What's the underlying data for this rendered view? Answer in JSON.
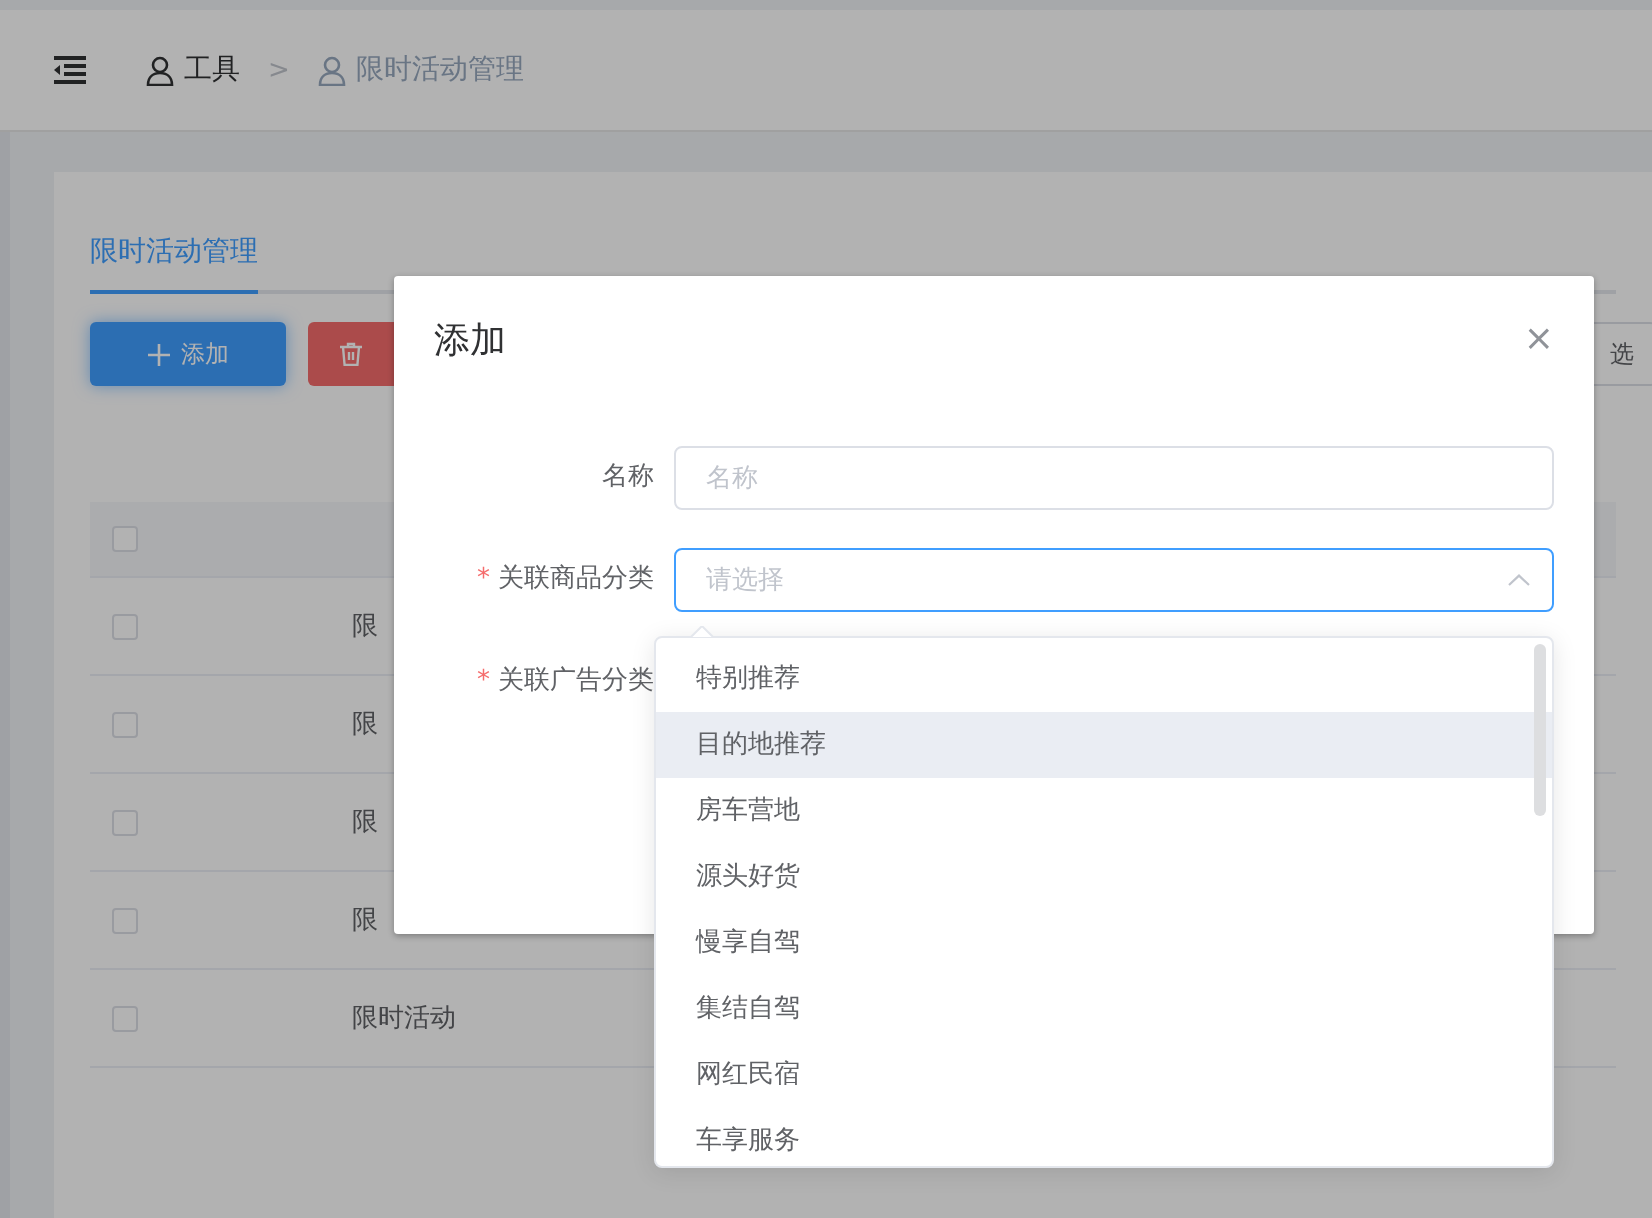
{
  "breadcrumb": {
    "items": [
      {
        "label": "工具"
      },
      {
        "label": "限时活动管理"
      }
    ],
    "separator": ">"
  },
  "tabs": [
    {
      "label": "限时活动管理",
      "selected": true
    }
  ],
  "toolbar": {
    "buttons": [
      {
        "kind": "primary",
        "label": "添加"
      },
      {
        "kind": "danger"
      }
    ],
    "filter_button": "选"
  },
  "table": {
    "header_checked": false,
    "rows": [
      {
        "checked": false,
        "name": "限"
      },
      {
        "checked": false,
        "name": "限"
      },
      {
        "checked": false,
        "name": "限"
      },
      {
        "checked": false,
        "name": "限"
      },
      {
        "checked": false,
        "name": "限时活动"
      }
    ]
  },
  "dialog": {
    "title": "添加",
    "close": "×",
    "required_mark": "*",
    "fields": [
      {
        "kind": "input",
        "label": "名称",
        "required": false,
        "placeholder": "名称",
        "focused": false
      },
      {
        "kind": "select",
        "label": "关联商品分类",
        "required": true,
        "placeholder": "请选择",
        "focused": true
      },
      {
        "kind": "covered",
        "label": "关联广告分类",
        "required": true
      }
    ]
  },
  "dropdown": {
    "items": [
      {
        "label": "特别推荐",
        "highlighted": false
      },
      {
        "label": "目的地推荐",
        "highlighted": true
      },
      {
        "label": "房车营地",
        "highlighted": false
      },
      {
        "label": "源头好货",
        "highlighted": false
      },
      {
        "label": "慢享自驾",
        "highlighted": false
      },
      {
        "label": "集结自驾",
        "highlighted": false
      },
      {
        "label": "网红民宿",
        "highlighted": false
      },
      {
        "label": "车享服务",
        "highlighted": false
      }
    ]
  }
}
